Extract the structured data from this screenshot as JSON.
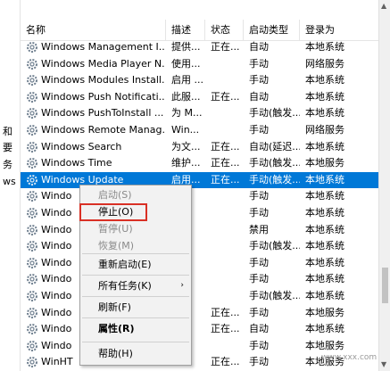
{
  "left_panel": {
    "fragments": [
      "和",
      "要",
      "务",
      "ws"
    ]
  },
  "columns": [
    "名称",
    "描述",
    "状态",
    "启动类型",
    "登录为"
  ],
  "rows": [
    {
      "name": "Windows Management I...",
      "desc": "提供...",
      "status": "正在...",
      "startup": "自动",
      "logon": "本地系统"
    },
    {
      "name": "Windows Media Player N...",
      "desc": "使用...",
      "status": "",
      "startup": "手动",
      "logon": "网络服务"
    },
    {
      "name": "Windows Modules Install...",
      "desc": "启用 ...",
      "status": "",
      "startup": "手动",
      "logon": "本地系统"
    },
    {
      "name": "Windows Push Notificati...",
      "desc": "此服...",
      "status": "正在...",
      "startup": "自动",
      "logon": "本地系统"
    },
    {
      "name": "Windows PushToInstall ...",
      "desc": "为 M...",
      "status": "",
      "startup": "手动(触发...",
      "logon": "本地系统"
    },
    {
      "name": "Windows Remote Manag...",
      "desc": "Win...",
      "status": "",
      "startup": "手动",
      "logon": "网络服务"
    },
    {
      "name": "Windows Search",
      "desc": "为文...",
      "status": "正在...",
      "startup": "自动(延迟...",
      "logon": "本地系统"
    },
    {
      "name": "Windows Time",
      "desc": "维护...",
      "status": "正在...",
      "startup": "手动(触发...",
      "logon": "本地服务"
    },
    {
      "name": "Windows Update",
      "desc": "启用...",
      "status": "正在...",
      "startup": "手动(触发...",
      "logon": "本地系统",
      "selected": true
    },
    {
      "name": "Windo",
      "desc": "",
      "status": "",
      "startup": "手动",
      "logon": "本地系统"
    },
    {
      "name": "Windo",
      "desc": "",
      "status": "",
      "startup": "手动",
      "logon": "本地系统"
    },
    {
      "name": "Windo",
      "desc": "",
      "status": "",
      "startup": "禁用",
      "logon": "本地系统"
    },
    {
      "name": "Windo",
      "desc": "",
      "status": "",
      "startup": "手动(触发...",
      "logon": "本地系统"
    },
    {
      "name": "Windo",
      "desc": "",
      "status": "",
      "startup": "手动",
      "logon": "本地系统"
    },
    {
      "name": "Windo",
      "desc": "",
      "status": "",
      "startup": "手动",
      "logon": "本地系统"
    },
    {
      "name": "Windo",
      "desc": "",
      "status": "",
      "startup": "手动(触发...",
      "logon": "本地系统"
    },
    {
      "name": "Windo",
      "desc": "",
      "status": "正在...",
      "startup": "手动",
      "logon": "本地服务"
    },
    {
      "name": "Windo",
      "desc": "",
      "status": "正在...",
      "startup": "自动",
      "logon": "本地系统"
    },
    {
      "name": "Windo",
      "desc": "",
      "status": "",
      "startup": "手动",
      "logon": "本地服务"
    },
    {
      "name": "WinHT",
      "desc": "",
      "status": "正在...",
      "startup": "手动",
      "logon": "本地服务"
    }
  ],
  "context_menu": {
    "items": [
      {
        "label": "启动(S)",
        "disabled": true
      },
      {
        "label": "停止(O)",
        "disabled": false,
        "highlighted": true
      },
      {
        "label": "暂停(U)",
        "disabled": true
      },
      {
        "label": "恢复(M)",
        "disabled": true
      },
      {
        "label": "重新启动(E)",
        "disabled": false
      },
      {
        "label": "所有任务(K)",
        "disabled": false,
        "submenu": true
      },
      {
        "label": "刷新(F)",
        "disabled": false
      },
      {
        "label": "属性(R)",
        "disabled": false,
        "bold": true
      },
      {
        "label": "帮助(H)",
        "disabled": false
      }
    ],
    "submenu_arrow": "›"
  },
  "watermark": "www.xxx.com"
}
